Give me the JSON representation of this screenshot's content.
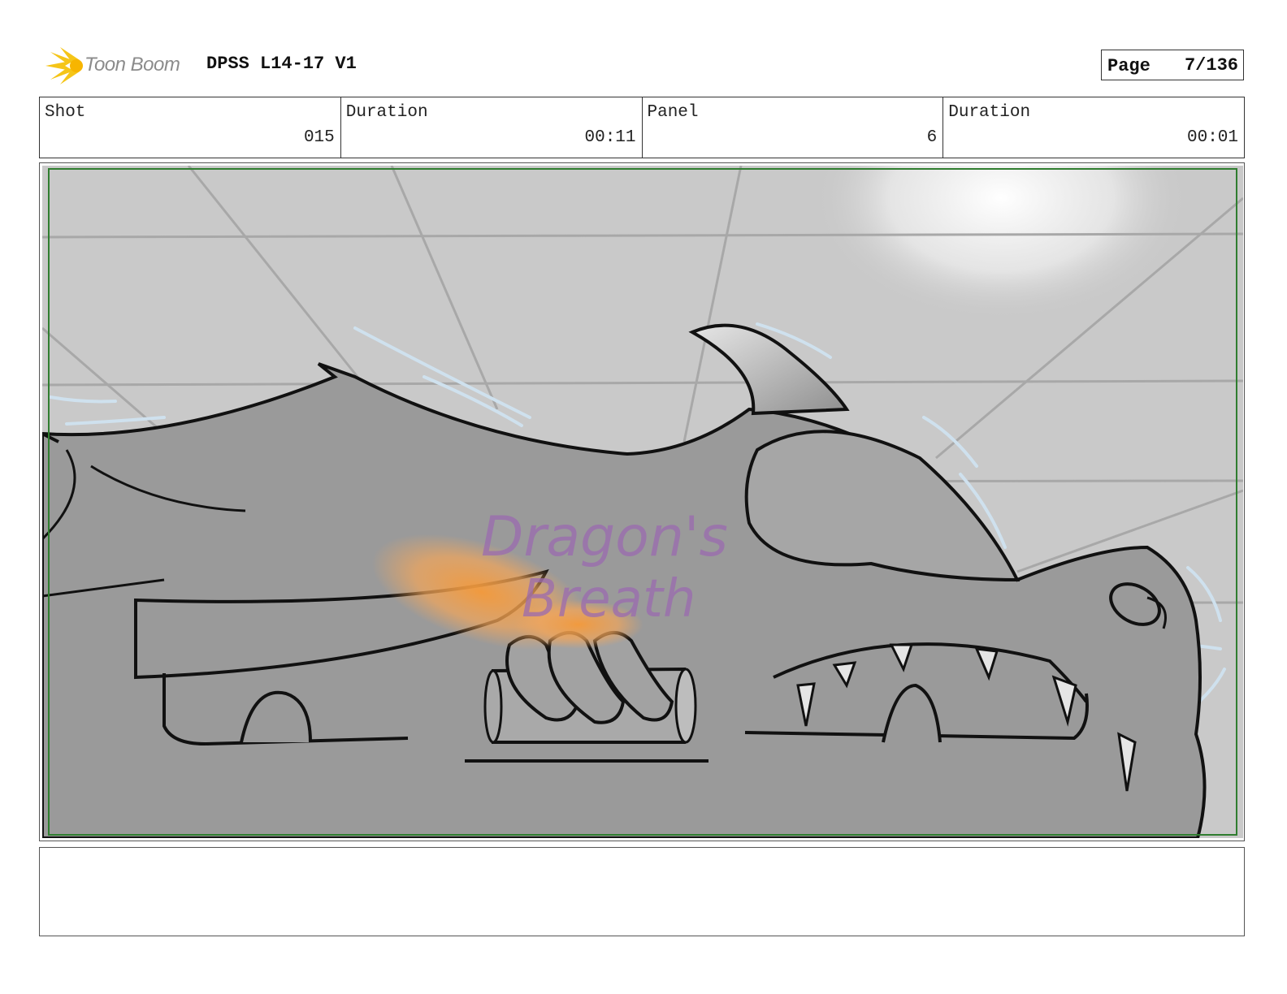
{
  "header": {
    "logo_text": "Toon Boom",
    "project_title": "DPSS L14-17 V1",
    "page_label": "Page",
    "page_value": "7/136"
  },
  "info": {
    "shot_label": "Shot",
    "shot_value": "015",
    "shot_duration_label": "Duration",
    "shot_duration_value": "00:11",
    "panel_label": "Panel",
    "panel_value": "6",
    "panel_duration_label": "Duration",
    "panel_duration_value": "00:01"
  },
  "panel": {
    "sign_line_1": "Dragon's",
    "sign_line_2": "Breath"
  },
  "notes": {
    "text": ""
  },
  "colors": {
    "safe_frame": "#2f7d2f",
    "background_wall": "#c9c9c9",
    "car_body": "#9a9a9a",
    "sign_text": "#9b6bb0",
    "flame": "#f08a2a"
  }
}
